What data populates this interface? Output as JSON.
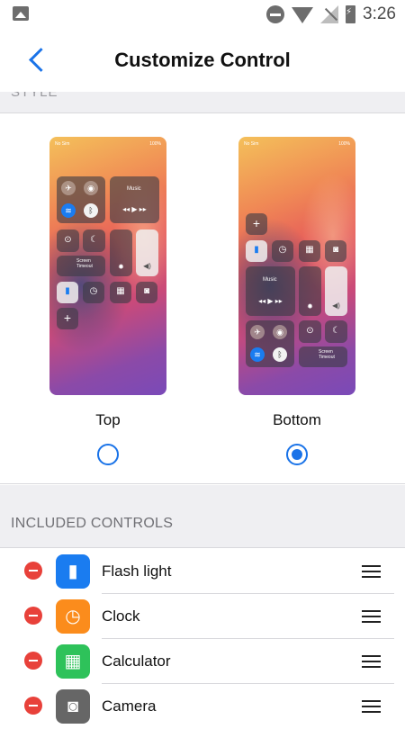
{
  "status_bar": {
    "time": "3:26"
  },
  "header": {
    "title": "Customize Control"
  },
  "style_section": {
    "heading": "STYLE",
    "options": [
      {
        "label": "Top",
        "selected": false
      },
      {
        "label": "Bottom",
        "selected": true
      }
    ],
    "preview": {
      "carrier": "No Sim",
      "battery": "100%",
      "music_label": "Music",
      "screen_timeout_label": "Screen Timeout"
    }
  },
  "included_controls": {
    "heading": "INCLUDED CONTROLS",
    "items": [
      {
        "label": "Flash light",
        "icon": "flashlight-icon",
        "color": "#1a7cf0"
      },
      {
        "label": "Clock",
        "icon": "clock-icon",
        "color": "#fb8c1c"
      },
      {
        "label": "Calculator",
        "icon": "calculator-icon",
        "color": "#2ec25a"
      },
      {
        "label": "Camera",
        "icon": "camera-icon",
        "color": "#666666"
      }
    ]
  }
}
